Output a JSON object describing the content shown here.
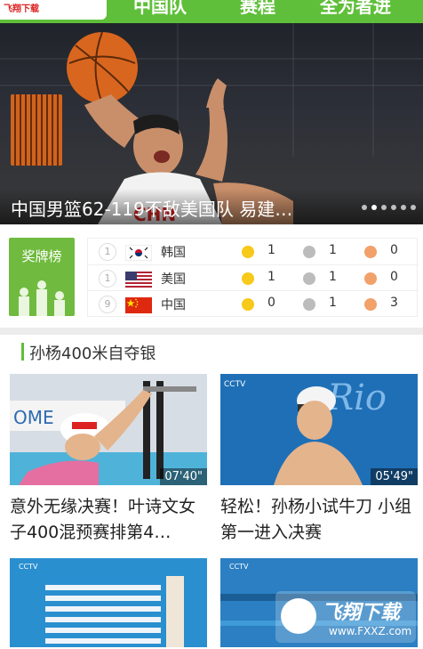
{
  "watermark_top": "飞翔下载 www.FXXZ.com",
  "nav": {
    "tabs": [
      "中国队",
      "赛程",
      "全为者进"
    ]
  },
  "hero": {
    "caption": "中国男篮62-119不敌美国队 易建…",
    "dots_total": 6,
    "active_dot": 1
  },
  "medals": {
    "title": "奖牌榜",
    "rows": [
      {
        "rank": "1",
        "country": "韩国",
        "gold": "1",
        "silver": "1",
        "bronze": "0"
      },
      {
        "rank": "1",
        "country": "美国",
        "gold": "1",
        "silver": "1",
        "bronze": "0"
      },
      {
        "rank": "9",
        "country": "中国",
        "gold": "0",
        "silver": "1",
        "bronze": "3"
      }
    ]
  },
  "section": {
    "title": "孙杨400米自夺银",
    "cards": [
      {
        "duration": "07'40\"",
        "title": "意外无缘决赛！叶诗文女子400混预赛排第4…"
      },
      {
        "duration": "05'49\"",
        "title": "轻松！孙杨小试牛刀 小组第一进入决赛"
      }
    ]
  },
  "watermark_bottom": {
    "brand": "飞翔下载",
    "url": "www.FXXZ.com"
  },
  "colors": {
    "brand_green": "#5fbf3a",
    "gold": "#f6c91a",
    "silver": "#bcbcbc",
    "bronze": "#f2a16a"
  }
}
